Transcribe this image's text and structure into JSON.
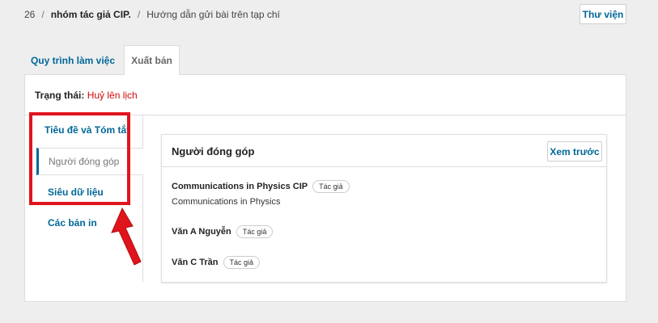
{
  "breadcrumb": {
    "id": "26",
    "author": "nhóm tác giả CIP.",
    "title": "Hướng dẫn gửi bài trên tạp chí"
  },
  "header": {
    "library_label": "Thư viện"
  },
  "tabs": [
    {
      "label": "Quy trình làm việc"
    },
    {
      "label": "Xuất bản"
    }
  ],
  "status": {
    "label": "Trạng thái:",
    "value": "Huỷ lên lịch",
    "value_color": "#d00a0a"
  },
  "side_nav": {
    "items": [
      {
        "label": "Tiêu đề và Tóm tắt"
      },
      {
        "label": "Người đóng góp"
      },
      {
        "label": "Siêu dữ liệu"
      },
      {
        "label": "Các bản in"
      }
    ]
  },
  "contributors": {
    "title": "Người đóng góp",
    "preview_label": "Xem trước",
    "items": [
      {
        "name": "Communications in Physics CIP",
        "role": "Tác giả",
        "affiliation": "Communications in Physics"
      },
      {
        "name": "Văn A Nguyễn",
        "role": "Tác giả"
      },
      {
        "name": "Văn C Trần",
        "role": "Tác giả"
      }
    ]
  },
  "colors": {
    "accent": "#006798",
    "annotation": "#e0141c",
    "background": "#eeeeee"
  }
}
